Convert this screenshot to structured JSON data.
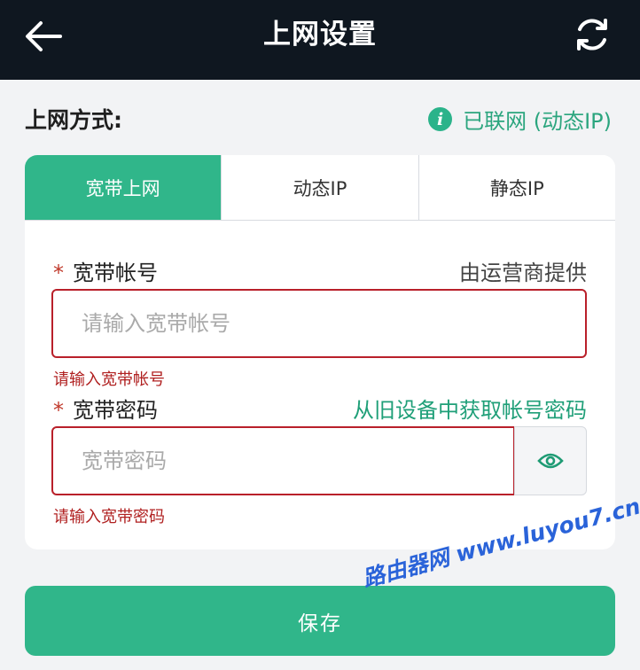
{
  "header": {
    "title": "上网设置",
    "back_icon": "arrow-left-icon",
    "refresh_icon": "refresh-icon"
  },
  "mode": {
    "label": "上网方式:",
    "status": "已联网 (动态IP)",
    "status_icon": "info-icon",
    "status_icon_glyph": "i"
  },
  "tabs": [
    {
      "label": "宽带上网",
      "active": true
    },
    {
      "label": "动态IP",
      "active": false
    },
    {
      "label": "静态IP",
      "active": false
    }
  ],
  "account": {
    "label": "宽带帐号",
    "required_mark": "*",
    "hint": "由运营商提供",
    "placeholder": "请输入宽带帐号",
    "value": "",
    "error": "请输入宽带帐号"
  },
  "password": {
    "label": "宽带密码",
    "required_mark": "*",
    "link": "从旧设备中获取帐号密码",
    "placeholder": "宽带密码",
    "value": "",
    "error": "请输入宽带密码",
    "toggle_icon": "eye-icon"
  },
  "save_label": "保存",
  "watermark": "路由器网 www.luyou7.cn",
  "colors": {
    "header_bg": "#0f1720",
    "accent": "#30b68a",
    "link": "#1f9f78",
    "error": "#b02020",
    "page_bg": "#f2f3f5"
  }
}
